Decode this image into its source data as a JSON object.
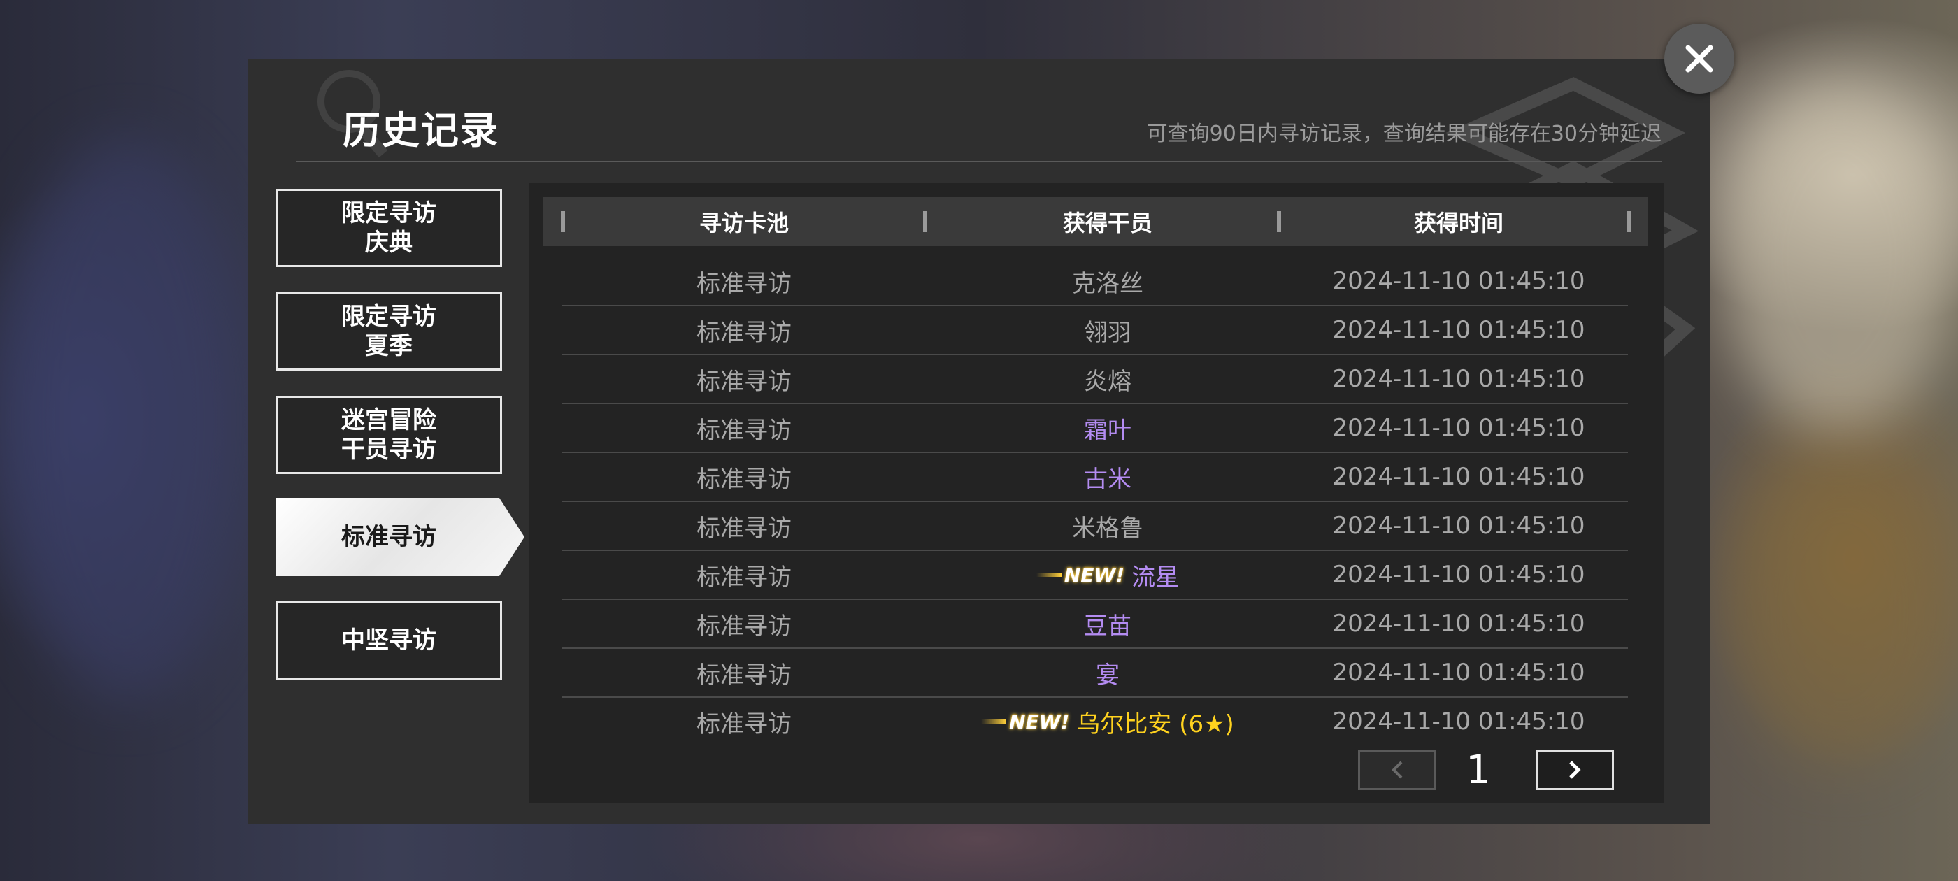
{
  "header": {
    "title": "历史记录",
    "subtitle": "可查询90日内寻访记录，查询结果可能存在30分钟延迟"
  },
  "tabs": [
    {
      "label": "限定寻访\n庆典",
      "active": false
    },
    {
      "label": "限定寻访\n夏季",
      "active": false
    },
    {
      "label": "迷宫冒险\n干员寻访",
      "active": false
    },
    {
      "label": "标准寻访",
      "active": true
    },
    {
      "label": "中坚寻访",
      "active": false
    }
  ],
  "table": {
    "columns": [
      "寻访卡池",
      "获得干员",
      "获得时间"
    ],
    "rows": [
      {
        "pool": "标准寻访",
        "operator": "克洛丝",
        "rarity": "gray",
        "new": false,
        "time": "2024-11-10 01:45:10"
      },
      {
        "pool": "标准寻访",
        "operator": "翎羽",
        "rarity": "gray",
        "new": false,
        "time": "2024-11-10 01:45:10"
      },
      {
        "pool": "标准寻访",
        "operator": "炎熔",
        "rarity": "gray",
        "new": false,
        "time": "2024-11-10 01:45:10"
      },
      {
        "pool": "标准寻访",
        "operator": "霜叶",
        "rarity": "purple",
        "new": false,
        "time": "2024-11-10 01:45:10"
      },
      {
        "pool": "标准寻访",
        "operator": "古米",
        "rarity": "purple",
        "new": false,
        "time": "2024-11-10 01:45:10"
      },
      {
        "pool": "标准寻访",
        "operator": "米格鲁",
        "rarity": "gray",
        "new": false,
        "time": "2024-11-10 01:45:10"
      },
      {
        "pool": "标准寻访",
        "operator": "流星",
        "rarity": "purple",
        "new": true,
        "time": "2024-11-10 01:45:10"
      },
      {
        "pool": "标准寻访",
        "operator": "豆苗",
        "rarity": "purple",
        "new": false,
        "time": "2024-11-10 01:45:10"
      },
      {
        "pool": "标准寻访",
        "operator": "宴",
        "rarity": "purple",
        "new": false,
        "time": "2024-11-10 01:45:10"
      },
      {
        "pool": "标准寻访",
        "operator": "乌尔比安 (6★)",
        "rarity": "gold",
        "new": true,
        "time": "2024-11-10 01:45:10"
      }
    ],
    "new_label": "NEW!"
  },
  "pager": {
    "page": "1",
    "prev_icon": "chevron-left-icon",
    "next_icon": "chevron-right-icon"
  },
  "close_icon": "close-icon",
  "colors": {
    "panel": "#2f2f2f",
    "table_bg": "#232323",
    "header_bg": "#3a3a3a",
    "text_gray": "#a9a9a9",
    "operator_purple": "#b48cf2",
    "operator_gold": "#ffd21e"
  }
}
